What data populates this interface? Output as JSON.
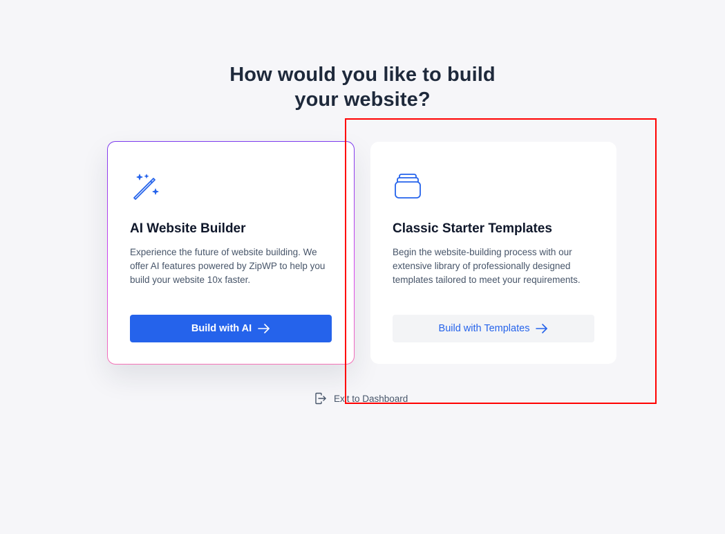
{
  "heading": {
    "line1": "How would you like to build",
    "line2": "your website?"
  },
  "cards": [
    {
      "icon": "magic-wand-icon",
      "title": "AI Website Builder",
      "description": "Experience the future of website building. We offer AI features powered by ZipWP to help you build your website 10x faster.",
      "button_label": "Build with AI"
    },
    {
      "icon": "templates-stack-icon",
      "title": "Classic Starter Templates",
      "description": "Begin the website-building process with our extensive library of professionally designed templates tailored to meet your requirements.",
      "button_label": "Build with Templates"
    }
  ],
  "exit_link": {
    "icon": "exit-icon",
    "label": "Exit to Dashboard"
  },
  "colors": {
    "primary": "#2563eb",
    "background": "#f6f6f9",
    "highlight": "#ff0000"
  }
}
